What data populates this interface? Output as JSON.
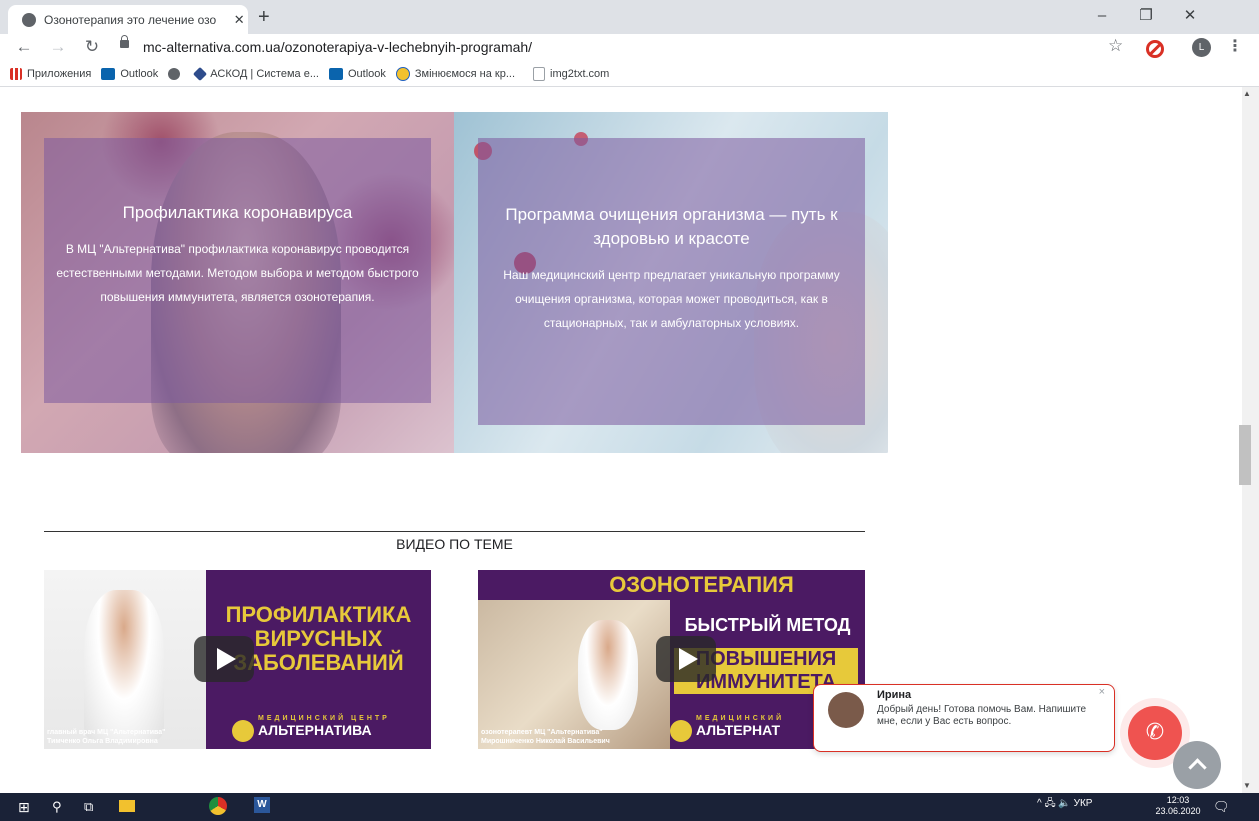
{
  "browser": {
    "tab_title": "Озонотерапия это лечение озо",
    "tab_close": "✕",
    "new_tab": "+",
    "url": "mc-alternativa.com.ua/ozonoterapiya-v-lechebnyih-programah/",
    "avatar_letter": "L",
    "window_controls": [
      "–",
      "❐",
      "✕"
    ]
  },
  "bookmarks": [
    {
      "label": "Приложения",
      "icon": "apps-grid-icon",
      "color": "#d93025"
    },
    {
      "label": "Outlook",
      "icon": "outlook-icon",
      "color": "#0a64ad"
    },
    {
      "label": "",
      "icon": "globe-icon",
      "color": "#5f6368"
    },
    {
      "label": "АСКОД | Система е...",
      "icon": "askod-icon",
      "color": "#2e4c8c"
    },
    {
      "label": "Outlook",
      "icon": "outlook-icon",
      "color": "#0a64ad"
    },
    {
      "label": "Змінюємося на кр...",
      "icon": "ukraine-emblem-icon",
      "color": "#1f5fbf"
    },
    {
      "label": "img2txt.com",
      "icon": "document-icon",
      "color": "#9aa0a6"
    }
  ],
  "panels": [
    {
      "title": "Профилактика коронавируса",
      "text": "В МЦ \"Альтернатива\" профилактика коронавирус проводится естественными методами. Методом выбора и методом быстрого повышения иммунитета, является озонотерапия."
    },
    {
      "title": "Программа очищения организма — путь к здоровью и красоте",
      "text": "Наш медицинский центр предлагает уникальную программу очищения организма, которая может проводиться, как в стационарных, так и амбулаторных условиях."
    }
  ],
  "video_section": {
    "title": "ВИДЕО ПО ТЕМЕ",
    "videos": [
      {
        "lines": [
          "ПРОФИЛАКТИКА",
          "ВИРУСНЫХ",
          "ЗАБОЛЕВАНИЙ"
        ],
        "caption_1": "главный врач МЦ \"Альтернатива\"",
        "caption_2": "Тимченко Ольга Владимировна",
        "brand_small": "МЕДИЦИНСКИЙ ЦЕНТР",
        "brand": "АЛЬТЕРНАТИВА"
      },
      {
        "lines": [
          "ОЗОНОТЕРАПИЯ",
          "БЫСТРЫЙ МЕТОД",
          "ПОВЫШЕНИЯ",
          "ИММУНИТЕТА"
        ],
        "caption_1": "озонотерапевт МЦ \"Альтернатива\"",
        "caption_2": "Мирошниченко Николай Васильевич",
        "brand_small": "МЕДИЦИНСКИЙ",
        "brand": "АЛЬТЕРНАТ"
      }
    ]
  },
  "chat": {
    "name": "Ирина",
    "message": "Добрый день! Готова помочь Вам. Напишите мне, если у Вас есть вопрос.",
    "close": "×"
  },
  "taskbar": {
    "tray": "^  🖧  🔈  УКР",
    "time": "12:03",
    "date": "23.06.2020"
  },
  "colors": {
    "accent_red": "#ef5350",
    "overlay_purple": "#7b5a9e",
    "video_purple": "#4b1a63",
    "brand_yellow": "#e7c93a"
  }
}
